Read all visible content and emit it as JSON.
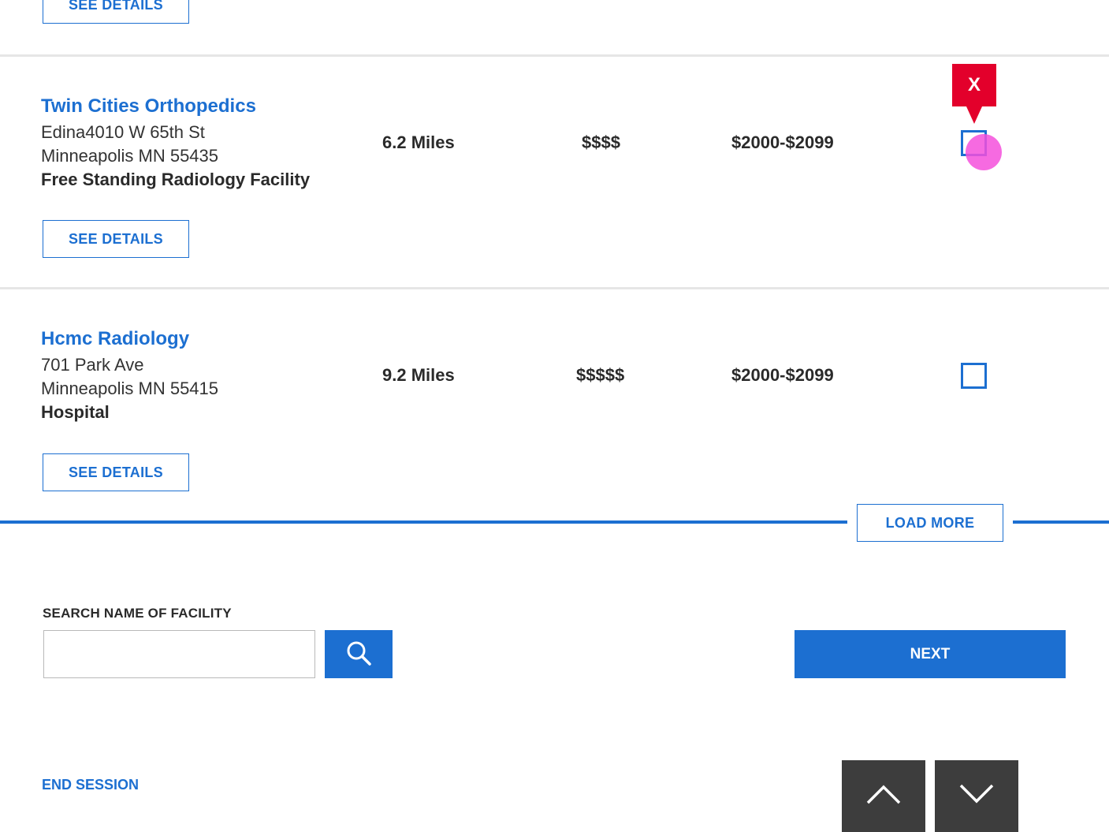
{
  "facilities": [
    {
      "see_details_label": "SEE DETAILS"
    },
    {
      "name": "Twin Cities Orthopedics",
      "address_line1": "Edina4010 W 65th St",
      "address_line2": "Minneapolis MN 55435",
      "type": "Free Standing Radiology Facility",
      "distance": "6.2 Miles",
      "cost_level": "$$$$",
      "price_range": "$2000-$2099",
      "see_details_label": "SEE DETAILS",
      "marker_label": "X"
    },
    {
      "name": "Hcmc Radiology",
      "address_line1": "701 Park Ave",
      "address_line2": "Minneapolis MN 55415",
      "type": "Hospital",
      "distance": "9.2 Miles",
      "cost_level": "$$$$$",
      "price_range": "$2000-$2099",
      "see_details_label": "SEE DETAILS"
    }
  ],
  "load_more_label": "LOAD MORE",
  "search": {
    "label": "SEARCH NAME OF FACILITY",
    "value": "",
    "placeholder": ""
  },
  "next_label": "NEXT",
  "end_session_label": "END SESSION",
  "icons": {
    "search": "search-icon",
    "scroll_up": "chevron-up-icon",
    "scroll_down": "chevron-down-icon"
  },
  "colors": {
    "primary": "#1c6fd1",
    "marker": "#e3002b",
    "scroll_button": "#3d3d3d"
  }
}
